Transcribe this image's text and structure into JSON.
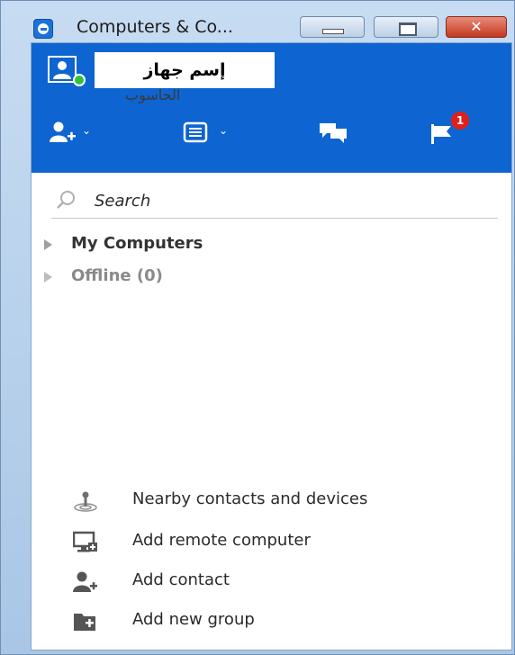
{
  "window": {
    "title": "Computers & Co...",
    "controls": {
      "close_glyph": "✕"
    }
  },
  "header": {
    "device_name": "إسم جهاز",
    "device_name_sub": "الحاسوب",
    "status_color": "#2ec23f",
    "header_color": "#0e64d0",
    "notification_count": "1",
    "toolbar_icons": [
      "add-contact-icon",
      "list-view-icon",
      "chat-icon",
      "flag-icon"
    ]
  },
  "search": {
    "placeholder": "Search"
  },
  "groups": [
    {
      "label": "My Computers"
    },
    {
      "label": "Offline (0)"
    }
  ],
  "actions": [
    {
      "label": "Nearby contacts and devices",
      "icon": "nearby-icon"
    },
    {
      "label": "Add remote computer",
      "icon": "add-computer-icon"
    },
    {
      "label": "Add contact",
      "icon": "add-contact-icon"
    },
    {
      "label": "Add new group",
      "icon": "add-group-icon"
    }
  ]
}
